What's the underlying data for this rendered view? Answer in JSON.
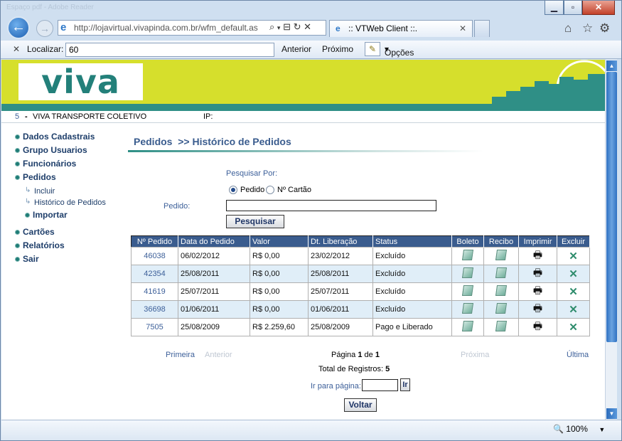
{
  "browser": {
    "title_faded": "Espaço pdf - Adobe Reader",
    "address": "http://lojavirtual.vivapinda.com.br/wfm_default.as",
    "tab_title": ":: VTWeb Client ::.",
    "find_label": "Localizar:",
    "find_value": "60",
    "find_prev": "Anterior",
    "find_next": "Próximo",
    "find_options": "Opções",
    "zoom": "100%"
  },
  "site": {
    "logo": "viva",
    "company_code": "5",
    "company_sep": "-",
    "company_name": "VIVA TRANSPORTE COLETIVO",
    "ip_label": "IP:"
  },
  "sidebar": {
    "items": [
      {
        "label": "Dados Cadastrais"
      },
      {
        "label": "Grupo Usuarios"
      },
      {
        "label": "Funcionários"
      },
      {
        "label": "Pedidos"
      },
      {
        "label": "Cartões"
      },
      {
        "label": "Relatórios"
      },
      {
        "label": "Sair"
      }
    ],
    "sub": [
      {
        "label": "Incluir"
      },
      {
        "label": "Histórico de Pedidos"
      },
      {
        "label": "Importar"
      }
    ]
  },
  "main": {
    "heading": "Pedidos  >> Histórico de Pedidos",
    "search_by": "Pesquisar Por:",
    "radio_pedido": "Pedido",
    "radio_cartao": "Nº Cartão",
    "pedido_label": "Pedido:",
    "search_button": "Pesquisar",
    "columns": [
      "Nº Pedido",
      "Data do Pedido",
      "Valor",
      "Dt. Liberação",
      "Status",
      "Boleto",
      "Recibo",
      "Imprimir",
      "Excluir"
    ],
    "rows": [
      {
        "id": "46038",
        "date": "06/02/2012",
        "value": "R$ 0,00",
        "release": "23/02/2012",
        "status": "Excluído"
      },
      {
        "id": "42354",
        "date": "25/08/2011",
        "value": "R$ 0,00",
        "release": "25/08/2011",
        "status": "Excluído"
      },
      {
        "id": "41619",
        "date": "25/07/2011",
        "value": "R$ 0,00",
        "release": "25/07/2011",
        "status": "Excluído"
      },
      {
        "id": "36698",
        "date": "01/06/2011",
        "value": "R$ 0,00",
        "release": "01/06/2011",
        "status": "Excluído"
      },
      {
        "id": "7505",
        "date": "25/08/2009",
        "value": "R$ 2.259,60",
        "release": "25/08/2009",
        "status": "Pago e Liberado"
      }
    ],
    "pager": {
      "first": "Primeira",
      "prev": "Anterior",
      "page_text_prefix": "Página",
      "page_current": "1",
      "page_of": "de",
      "page_total": "1",
      "next": "Próxima",
      "last": "Última",
      "total_label": "Total de Registros:",
      "total_value": "5",
      "goto_label": "Ir para página:",
      "goto_button": "Ir",
      "back_button": "Voltar"
    }
  },
  "colors": {
    "banner": "#d6df2c",
    "teal": "#2f8f86",
    "header_blue": "#3a5c8e",
    "alt_row": "#e0eef8"
  }
}
